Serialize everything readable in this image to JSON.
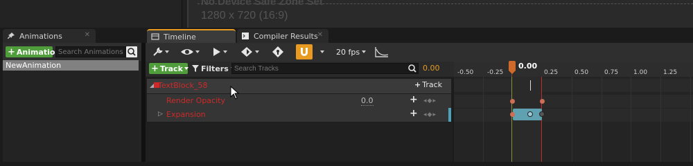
{
  "viewport": {
    "safe_zone_text": "No Device Safe Zone Set",
    "resolution_text": "1280 x 720 (16:9)"
  },
  "tabs": {
    "animations": {
      "label": "Animations",
      "icon": "pin-icon",
      "close": "✕"
    },
    "timeline": {
      "label": "Timeline",
      "icon": "timeline-icon"
    },
    "compiler": {
      "label": "Compiler Results",
      "icon": "compiler-icon",
      "close": "✕"
    }
  },
  "animations_panel": {
    "add_button_label": "Animation",
    "search_placeholder": "Search Animations",
    "items": [
      {
        "label": "NewAnimation",
        "selected": true
      }
    ]
  },
  "toolbar": {
    "tools_icon": "wrench-icon",
    "view_icon": "eye-icon",
    "play_icon": "play-icon",
    "key_icon": "key-diamond-icon",
    "lock_icon": "key-lock-icon",
    "snap_icon": "magnet-icon",
    "fps_label": "20 fps",
    "curve_icon": "curve-editor-icon"
  },
  "track_header": {
    "add_track_label": "Track",
    "filters_label": "Filters",
    "search_placeholder": "Search Tracks",
    "current_time": "0.00"
  },
  "tracks": [
    {
      "label": "TextBlock_58",
      "add_label": "Track",
      "level": 0
    },
    {
      "label": "Render Opacity",
      "value": "0.0",
      "level": 1
    },
    {
      "label": "Expansion",
      "level": 1
    }
  ],
  "timeline": {
    "current_time": "0.00",
    "ticks": [
      "-0.50",
      "-0.25",
      "0.25",
      "0.50",
      "0.75",
      "1.00",
      "1.25"
    ],
    "colors": {
      "start": "#3dbd4a",
      "end": "#c22a2a",
      "playhead": "#d06a2a",
      "section": "#5fa0b1",
      "accent": "#e89b20"
    }
  }
}
